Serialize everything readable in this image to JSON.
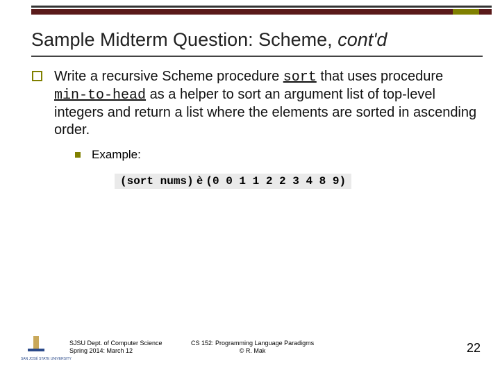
{
  "title": {
    "prefix": "Sample Midterm Question: Scheme, ",
    "italic": "cont'd"
  },
  "body": {
    "t1": "Write a recursive Scheme procedure ",
    "code1": "sort",
    "t2": " that uses procedure ",
    "code2": "min-to-head",
    "t3": " as a helper to sort an argument list of top-level integers and return a list where the elements are sorted in ascending order."
  },
  "example": {
    "label": "Example:",
    "code_left": "(sort nums)",
    "arrow": " è ",
    "code_right": "(0 0 1 1 2 2 3 4 8 9)"
  },
  "footer": {
    "left_line1": "SJSU Dept. of Computer Science",
    "left_line2": "Spring 2014: March 12",
    "center_line1": "CS 152: Programming Language Paradigms",
    "center_line2": "© R. Mak",
    "page": "22",
    "logo_text": "SAN JOSÉ STATE UNIVERSITY"
  }
}
